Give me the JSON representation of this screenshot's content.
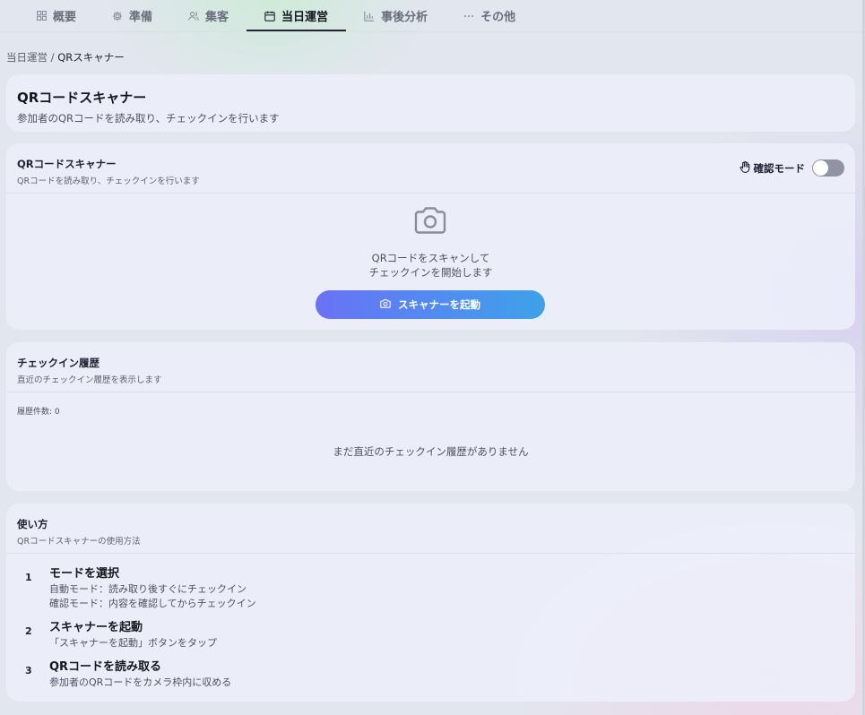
{
  "tabs": [
    {
      "label": "概要",
      "icon": "grid-icon"
    },
    {
      "label": "準備",
      "icon": "gear-icon"
    },
    {
      "label": "集客",
      "icon": "users-icon"
    },
    {
      "label": "当日運営",
      "icon": "calendar-icon"
    },
    {
      "label": "事後分析",
      "icon": "bar-chart-icon"
    },
    {
      "label": "その他",
      "icon": "more-icon"
    }
  ],
  "active_tab": "当日運営",
  "breadcrumb": {
    "parent": "当日運営",
    "separator": " / ",
    "current": "QRスキャナー"
  },
  "page": {
    "title": "QRコードスキャナー",
    "subtitle": "参加者のQRコードを読み取り、チェックインを行います"
  },
  "scanner": {
    "title": "QRコードスキャナー",
    "subtitle": "QRコードを読み取り、チェックインを行います",
    "confirm_mode_label": "確認モード",
    "confirm_mode_on": false,
    "prompt_line1": "QRコードをスキャンして",
    "prompt_line2": "チェックインを開始します",
    "start_button": "スキャナーを起動"
  },
  "history": {
    "title": "チェックイン履歴",
    "subtitle": "直近のチェックイン履歴を表示します",
    "count_label": "履歴件数: 0",
    "empty_message": "まだ直近のチェックイン履歴がありません"
  },
  "howto": {
    "title": "使い方",
    "subtitle": "QRコードスキャナーの使用方法",
    "steps": [
      {
        "num": "1",
        "title": "モードを選択",
        "line1": "自動モード：読み取り後すぐにチェックイン",
        "line2": "確認モード：内容を確認してからチェックイン"
      },
      {
        "num": "2",
        "title": "スキャナーを起動",
        "line1": "「スキャナーを起動」ボタンをタップ"
      },
      {
        "num": "3",
        "title": "QRコードを読み取る",
        "line1": "参加者のQRコードをカメラ枠内に収める"
      }
    ]
  },
  "colors": {
    "button_gradient_start": "#6a72f5",
    "button_gradient_end": "#3ea1e8",
    "toggle_off": "#8f93a2"
  }
}
